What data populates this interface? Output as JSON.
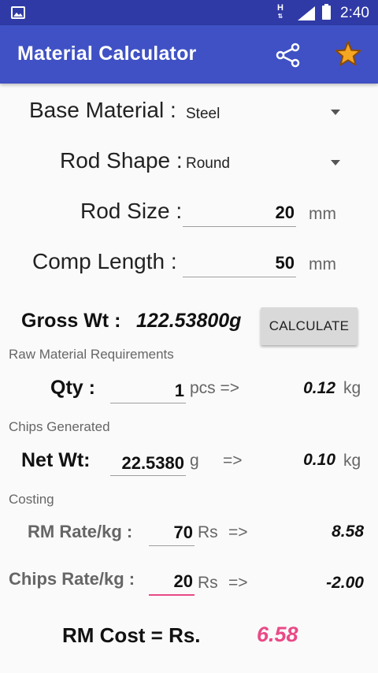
{
  "status_bar": {
    "network": "H",
    "time": "2:40"
  },
  "app_bar": {
    "title": "Material Calculator",
    "share_icon": "share-icon",
    "star_icon": "star-icon"
  },
  "colors": {
    "primary": "#3f51c4",
    "primary_dark": "#2f3aa6",
    "accent": "#e94a86",
    "star": "#f5a623"
  },
  "form": {
    "base_material": {
      "label": "Base Material :",
      "value": "Steel"
    },
    "rod_shape": {
      "label": "Rod Shape :",
      "value": "Round"
    },
    "rod_size": {
      "label": "Rod Size :",
      "value": "20",
      "unit": "mm"
    },
    "comp_length": {
      "label": "Comp Length :",
      "value": "50",
      "unit": "mm"
    }
  },
  "gross": {
    "label": "Gross Wt :",
    "value": "122.53800g"
  },
  "calculate_label": "CALCULATE",
  "raw_material": {
    "section": "Raw Material Requirements",
    "qty_label": "Qty :",
    "qty_value": "1",
    "qty_unit": "pcs =>",
    "result": "0.12",
    "result_unit": "kg"
  },
  "chips": {
    "section": "Chips Generated",
    "label": "Net Wt:",
    "value": "22.5380",
    "unit": "g",
    "arrow": "=>",
    "result": "0.10",
    "result_unit": "kg"
  },
  "costing": {
    "section": "Costing",
    "rm_rate_label": "RM Rate/kg :",
    "rm_rate_value": "70",
    "rm_rate_unit": "Rs",
    "rm_arrow": "=>",
    "rm_result": "8.58",
    "chips_rate_label": "Chips Rate/kg :",
    "chips_rate_value": "20",
    "chips_rate_unit": "Rs",
    "chips_arrow": "=>",
    "chips_result": "-2.00"
  },
  "total": {
    "label": "RM Cost = Rs.",
    "value": "6.58"
  }
}
